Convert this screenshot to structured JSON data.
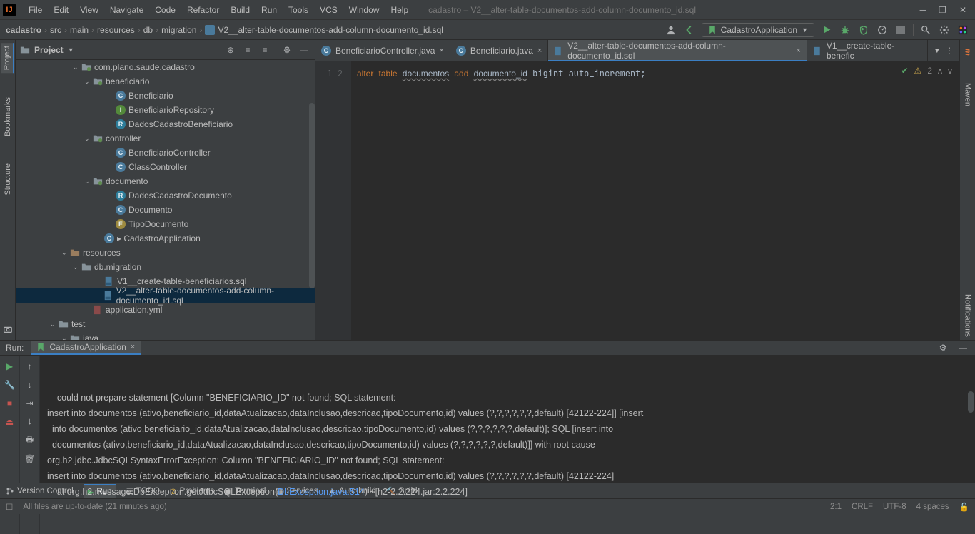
{
  "window": {
    "title": "cadastro – V2__alter-table-documentos-add-column-documento_id.sql"
  },
  "menu": [
    "File",
    "Edit",
    "View",
    "Navigate",
    "Code",
    "Refactor",
    "Build",
    "Run",
    "Tools",
    "VCS",
    "Window",
    "Help"
  ],
  "breadcrumb": [
    "cadastro",
    "src",
    "main",
    "resources",
    "db",
    "migration",
    "V2__alter-table-documentos-add-column-documento_id.sql"
  ],
  "run_config": {
    "name": "CadastroApplication"
  },
  "project_panel": {
    "title": "Project"
  },
  "tree": [
    {
      "indent": 5,
      "arrow": "v",
      "kind": "package",
      "label": "com.plano.saude.cadastro"
    },
    {
      "indent": 6,
      "arrow": "v",
      "kind": "package",
      "label": "beneficiario"
    },
    {
      "indent": 8,
      "arrow": "",
      "kind": "class",
      "badge": "C",
      "label": "Beneficiario"
    },
    {
      "indent": 8,
      "arrow": "",
      "kind": "interface",
      "badge": "I",
      "label": "BeneficiarioRepository"
    },
    {
      "indent": 8,
      "arrow": "",
      "kind": "record",
      "badge": "R",
      "label": "DadosCadastroBeneficiario"
    },
    {
      "indent": 6,
      "arrow": "v",
      "kind": "package",
      "label": "controller"
    },
    {
      "indent": 8,
      "arrow": "",
      "kind": "class",
      "badge": "C",
      "label": "BeneficiarioController"
    },
    {
      "indent": 8,
      "arrow": "",
      "kind": "class",
      "badge": "C",
      "label": "ClassController"
    },
    {
      "indent": 6,
      "arrow": "v",
      "kind": "package",
      "label": "documento"
    },
    {
      "indent": 8,
      "arrow": "",
      "kind": "record",
      "badge": "R",
      "label": "DadosCadastroDocumento"
    },
    {
      "indent": 8,
      "arrow": "",
      "kind": "class",
      "badge": "C",
      "label": "Documento"
    },
    {
      "indent": 8,
      "arrow": "",
      "kind": "enum",
      "badge": "E",
      "label": "TipoDocumento"
    },
    {
      "indent": 7,
      "arrow": "",
      "kind": "class",
      "badge": "C",
      "label": "CadastroApplication",
      "run": true
    },
    {
      "indent": 4,
      "arrow": "v",
      "kind": "folder-res",
      "label": "resources"
    },
    {
      "indent": 5,
      "arrow": "v",
      "kind": "folder",
      "label": "db.migration"
    },
    {
      "indent": 7,
      "arrow": "",
      "kind": "sql",
      "label": "V1__create-table-beneficiarios.sql"
    },
    {
      "indent": 7,
      "arrow": "",
      "kind": "sql",
      "label": "V2__alter-table-documentos-add-column-documento_id.sql",
      "selected": true
    },
    {
      "indent": 6,
      "arrow": "",
      "kind": "yml",
      "label": "application.yml"
    },
    {
      "indent": 3,
      "arrow": "v",
      "kind": "folder",
      "label": "test"
    },
    {
      "indent": 4,
      "arrow": "v",
      "kind": "folder",
      "label": "java"
    }
  ],
  "tabs": [
    {
      "icon": "class",
      "label": "BeneficiarioController.java",
      "active": false
    },
    {
      "icon": "class",
      "label": "Beneficiario.java",
      "active": false
    },
    {
      "icon": "sql",
      "label": "V2__alter-table-documentos-add-column-documento_id.sql",
      "active": true
    },
    {
      "icon": "sql",
      "label": "V1__create-table-benefic",
      "active": false,
      "truncated": true
    }
  ],
  "editor": {
    "lines": [
      "1",
      "2"
    ],
    "code_tokens": [
      {
        "t": "alter",
        "c": "kw"
      },
      {
        "t": " "
      },
      {
        "t": "table",
        "c": "kw"
      },
      {
        "t": " "
      },
      {
        "t": "documentos",
        "c": "id1"
      },
      {
        "t": " "
      },
      {
        "t": "add",
        "c": "kw"
      },
      {
        "t": " "
      },
      {
        "t": "documento_id",
        "c": "id1"
      },
      {
        "t": " bigint auto_increment;"
      }
    ],
    "problems_count": "2"
  },
  "run_panel": {
    "label": "Run:",
    "tab": "CadastroApplication"
  },
  "console_lines": [
    "    could not prepare statement [Column \"BENEFICIARIO_ID\" not found; SQL statement:",
    "insert into documentos (ativo,beneficiario_id,dataAtualizacao,dataInclusao,descricao,tipoDocumento,id) values (?,?,?,?,?,?,default) [42122-224]] [insert ",
    "  into documentos (ativo,beneficiario_id,dataAtualizacao,dataInclusao,descricao,tipoDocumento,id) values (?,?,?,?,?,?,default)]; SQL [insert into ",
    "  documentos (ativo,beneficiario_id,dataAtualizacao,dataInclusao,descricao,tipoDocumento,id) values (?,?,?,?,?,?,default)]] with root cause",
    "",
    "org.h2.jdbc.JdbcSQLSyntaxErrorException: Column \"BENEFICIARIO_ID\" not found; SQL statement:",
    "insert into documentos (ativo,beneficiario_id,dataAtualizacao,dataInclusao,descricao,tipoDocumento,id) values (?,?,?,?,?,?,default) [42122-224]"
  ],
  "console_link": {
    "pre": "    at org.h2.message.DbException.getJdbcSQLException(",
    "link": "DbException.java:514",
    "post": ") ~[h2-2.2.224.jar:2.2.224]"
  },
  "toolstrip": {
    "version_control": "Version Control",
    "run": "Run",
    "todo": "TODO",
    "problems": "Problems",
    "terminal": "Terminal",
    "services": "Services",
    "autobuild": "Auto-build",
    "build": "Build"
  },
  "status": {
    "left": "All files are up-to-date (21 minutes ago)",
    "pos": "2:1",
    "eol": "CRLF",
    "enc": "UTF-8",
    "indent": "4 spaces"
  },
  "left_tabs": {
    "project": "Project",
    "bookmarks": "Bookmarks",
    "structure": "Structure"
  },
  "right_tabs": {
    "maven": "Maven",
    "notifications": "Notifications"
  }
}
